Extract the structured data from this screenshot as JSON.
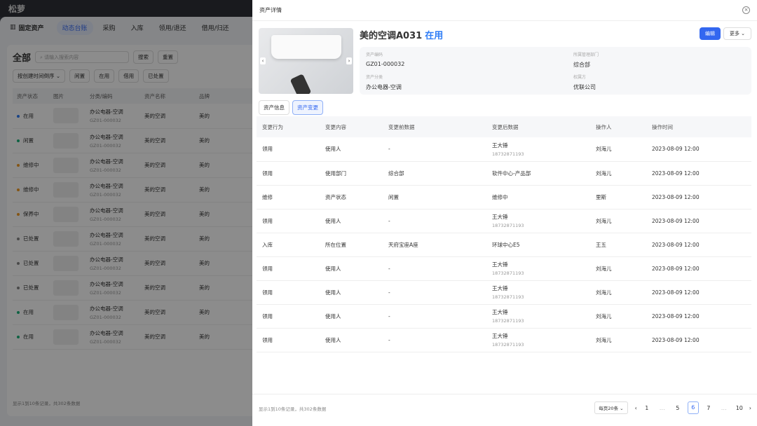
{
  "app": {
    "logo": "松萝",
    "module": "固定资产",
    "nav": [
      "动态台账",
      "采购",
      "入库",
      "领用/退还",
      "借用/归还"
    ]
  },
  "list": {
    "title": "全部",
    "search_placeholder": "请输入搜索内容",
    "search": "搜索",
    "reset": "重置",
    "sort": "按创建时间倒序",
    "filters": [
      "闲置",
      "在用",
      "借用",
      "已处置"
    ],
    "columns": [
      "资产状态",
      "图片",
      "分类/编码",
      "资产名称",
      "品牌"
    ],
    "rows": [
      {
        "status": "在用",
        "color": "#2f7df6",
        "cat": "办公电器-空调",
        "code": "GZ01-000032",
        "name": "美的空调",
        "brand": "美的"
      },
      {
        "status": "闲置",
        "color": "#1bb37a",
        "cat": "办公电器-空调",
        "code": "GZ01-000032",
        "name": "美的空调",
        "brand": "美的"
      },
      {
        "status": "维修中",
        "color": "#f39c25",
        "cat": "办公电器-空调",
        "code": "GZ01-000032",
        "name": "美的空调",
        "brand": "美的"
      },
      {
        "status": "维修中",
        "color": "#f39c25",
        "cat": "办公电器-空调",
        "code": "GZ01-000032",
        "name": "美的空调",
        "brand": "美的"
      },
      {
        "status": "保养中",
        "color": "#f39c25",
        "cat": "办公电器-空调",
        "code": "GZ01-000032",
        "name": "美的空调",
        "brand": "美的"
      },
      {
        "status": "已处置",
        "color": "#888888",
        "cat": "办公电器-空调",
        "code": "GZ01-000032",
        "name": "美的空调",
        "brand": "美的"
      },
      {
        "status": "已处置",
        "color": "#888888",
        "cat": "办公电器-空调",
        "code": "GZ01-000032",
        "name": "美的空调",
        "brand": "美的"
      },
      {
        "status": "已处置",
        "color": "#888888",
        "cat": "办公电器-空调",
        "code": "GZ01-000032",
        "name": "美的空调",
        "brand": "美的"
      },
      {
        "status": "在用",
        "color": "#1bb37a",
        "cat": "办公电器-空调",
        "code": "GZ01-000032",
        "name": "美的空调",
        "brand": "美的"
      },
      {
        "status": "在用",
        "color": "#1bb37a",
        "cat": "办公电器-空调",
        "code": "GZ01-000032",
        "name": "美的空调",
        "brand": "美的"
      }
    ],
    "footer": "显示1到10条记录，共302条数据"
  },
  "drawer": {
    "title": "资产详情",
    "asset_name": "美的空调A031",
    "asset_status": "在用",
    "edit": "编辑",
    "more": "更多",
    "fields": [
      {
        "label": "资产编码",
        "value": "GZ01-000032"
      },
      {
        "label": "所属管理部门",
        "value": "综合部"
      },
      {
        "label": "资产分类",
        "value": "办公电器-空调"
      },
      {
        "label": "权属方",
        "value": "优联公司"
      }
    ],
    "tabs": [
      "资产信息",
      "资产变更"
    ],
    "columns": [
      "变更行为",
      "变更内容",
      "变更前数据",
      "变更后数据",
      "操作人",
      "操作时间"
    ],
    "rows": [
      {
        "action": "领用",
        "content": "使用人",
        "before": "-",
        "after": "王大锤",
        "after_sub": "18732871193",
        "op": "刘海儿",
        "time": "2023-08-09 12:00"
      },
      {
        "action": "领用",
        "content": "使用部门",
        "before": "综合部",
        "after": "软件中心-产品部",
        "after_sub": "",
        "op": "刘海儿",
        "time": "2023-08-09 12:00"
      },
      {
        "action": "维修",
        "content": "资产状态",
        "before": "闲置",
        "after": "维修中",
        "after_sub": "",
        "op": "里斯",
        "time": "2023-08-09 12:00"
      },
      {
        "action": "领用",
        "content": "使用人",
        "before": "-",
        "after": "王大锤",
        "after_sub": "18732871193",
        "op": "刘海儿",
        "time": "2023-08-09 12:00"
      },
      {
        "action": "入库",
        "content": "所在位置",
        "before": "天府宝座A座",
        "after": "环球中心E5",
        "after_sub": "",
        "op": "王五",
        "time": "2023-08-09 12:00"
      },
      {
        "action": "领用",
        "content": "使用人",
        "before": "-",
        "after": "王大锤",
        "after_sub": "18732871193",
        "op": "刘海儿",
        "time": "2023-08-09 12:00"
      },
      {
        "action": "领用",
        "content": "使用人",
        "before": "-",
        "after": "王大锤",
        "after_sub": "18732871193",
        "op": "刘海儿",
        "time": "2023-08-09 12:00"
      },
      {
        "action": "领用",
        "content": "使用人",
        "before": "-",
        "after": "王大锤",
        "after_sub": "18732871193",
        "op": "刘海儿",
        "time": "2023-08-09 12:00"
      },
      {
        "action": "领用",
        "content": "使用人",
        "before": "-",
        "after": "王大锤",
        "after_sub": "18732871193",
        "op": "刘海儿",
        "time": "2023-08-09 12:00"
      }
    ],
    "footer": "显示1到10条记录，共302条数据",
    "page_size": "每页20条",
    "pages": [
      "1",
      "…",
      "5",
      "6",
      "7",
      "…",
      "10"
    ],
    "current_page": "6"
  }
}
